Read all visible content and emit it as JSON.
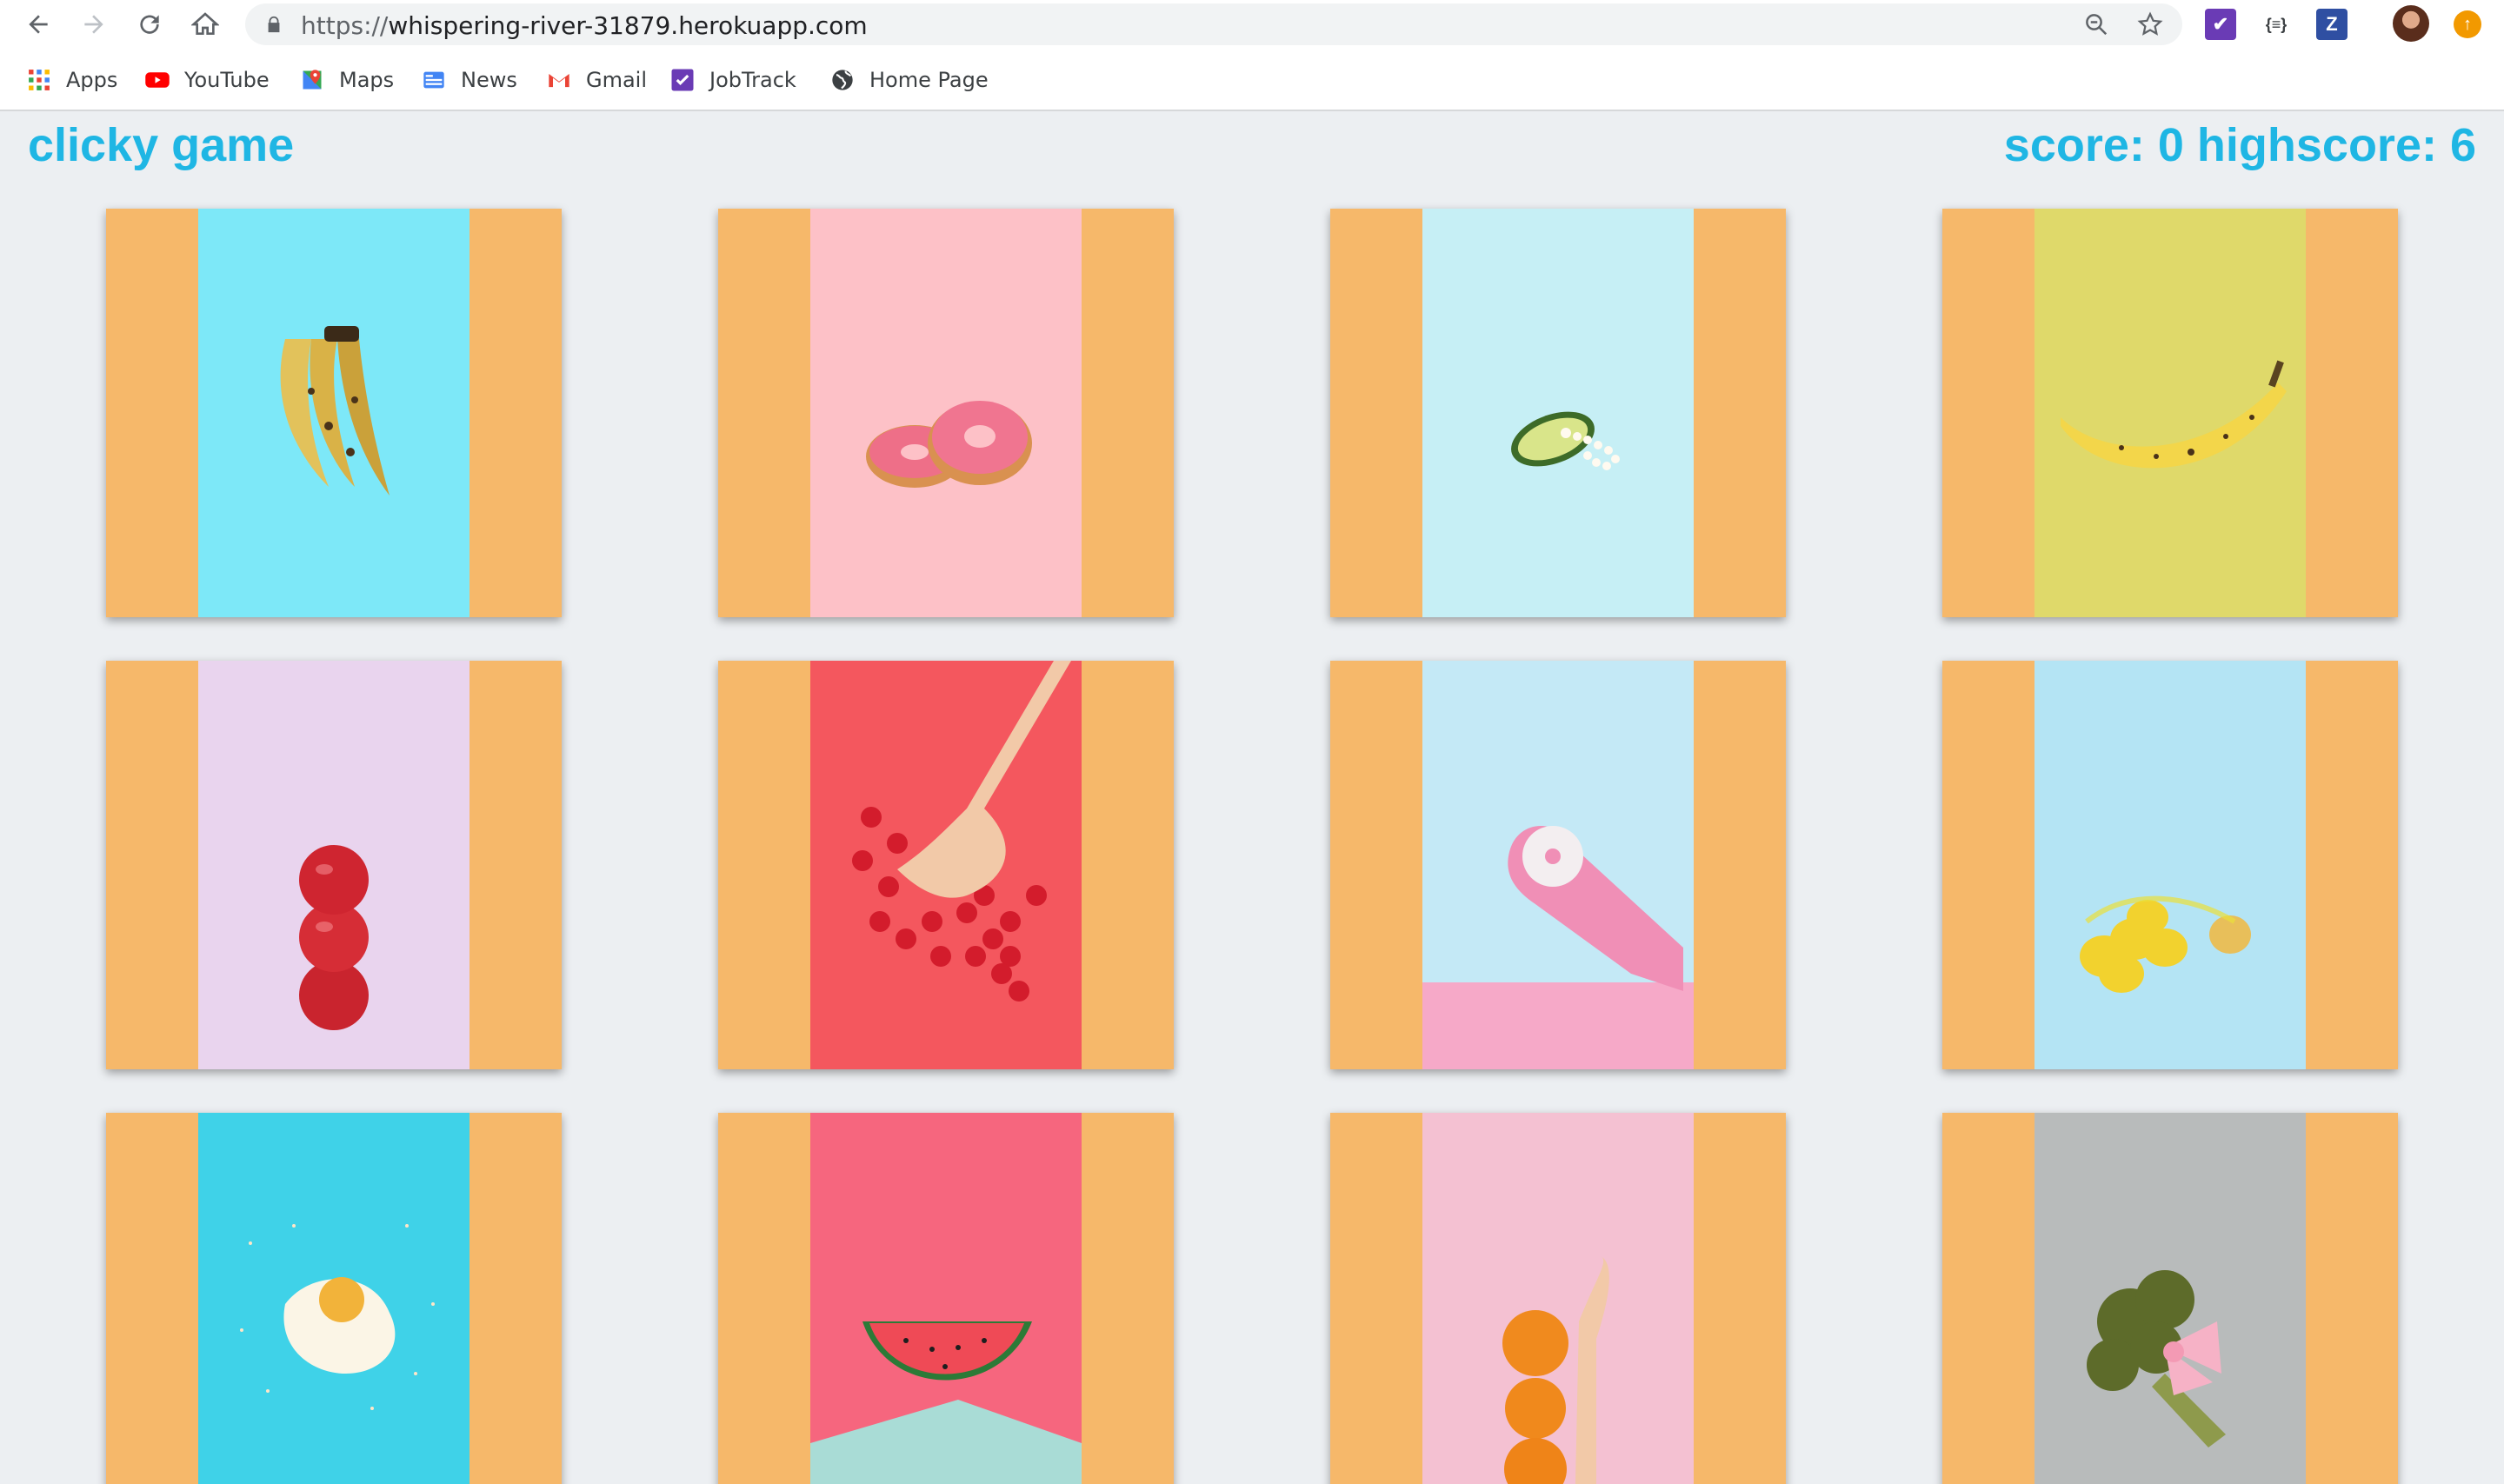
{
  "browser": {
    "url_protocol": "https://",
    "url_host": "whispering-river-31879.herokuapp.com",
    "extension_z_label": "Z",
    "extension_json_label": "{≡}"
  },
  "bookmarks": [
    {
      "label": "Apps",
      "icon": "apps-grid-icon"
    },
    {
      "label": "YouTube",
      "icon": "youtube-icon"
    },
    {
      "label": "Maps",
      "icon": "maps-icon"
    },
    {
      "label": "News",
      "icon": "news-icon"
    },
    {
      "label": "Gmail",
      "icon": "gmail-icon"
    },
    {
      "label": "JobTrack",
      "icon": "jobtrack-icon"
    },
    {
      "label": "Home Page",
      "icon": "globe-icon"
    }
  ],
  "game": {
    "title": "clicky game",
    "score_text": "score: 0 highscore: 6",
    "accent_color": "#1fb6e4",
    "card_frame_color": "#f6b86a"
  },
  "cards": [
    {
      "name": "bananas-bunch",
      "bg": "#7de8f8"
    },
    {
      "name": "pink-donuts",
      "bg": "#fdc1c7"
    },
    {
      "name": "avocado-pearls",
      "bg": "#c6eff5"
    },
    {
      "name": "single-banana",
      "bg": "#dfd96a"
    },
    {
      "name": "stacked-apples",
      "bg": "#e9d4ee"
    },
    {
      "name": "hand-strawberries",
      "bg": "#f4575e"
    },
    {
      "name": "glove-donut",
      "bg": "#c4e9f6"
    },
    {
      "name": "lemons-net",
      "bg": "#b4e4f4"
    },
    {
      "name": "fried-egg-sprinkles",
      "bg": "#3fd2e8"
    },
    {
      "name": "watermelon-slice",
      "bg": "#f6667e"
    },
    {
      "name": "hand-oranges",
      "bg": "#f4c1d2"
    },
    {
      "name": "broccoli-bow",
      "bg": "#b8bbbb"
    }
  ]
}
